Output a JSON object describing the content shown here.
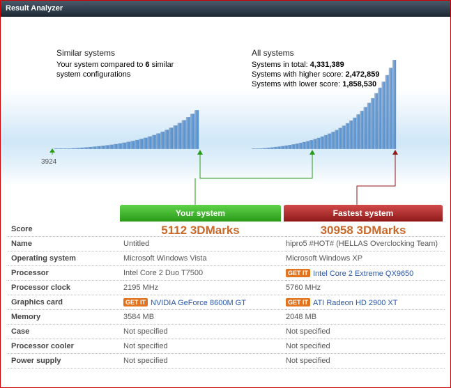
{
  "window": {
    "title": "Result Analyzer"
  },
  "similar": {
    "heading": "Similar systems",
    "line1_prefix": "Your system compared to ",
    "count": "6",
    "line1_suffix": " similar",
    "line2": "system configurations",
    "min_label": "3924"
  },
  "all": {
    "heading": "All systems",
    "total_label": "Systems in total: ",
    "total_value": "4,331,389",
    "higher_label": "Systems with higher score: ",
    "higher_value": "2,472,859",
    "lower_label": "Systems with lower score: ",
    "lower_value": "1,858,530"
  },
  "columns": {
    "yours": "Your system",
    "fastest": "Fastest system"
  },
  "scores": {
    "label": "Score",
    "yours": "5112 3DMarks",
    "fastest": "30958 3DMarks"
  },
  "rows": [
    {
      "label": "Name",
      "yours": "Untitled",
      "fastest": "hipro5 #HOT# (HELLAS Overclocking Team)"
    },
    {
      "label": "Operating system",
      "yours": "Microsoft Windows Vista",
      "fastest": "Microsoft Windows XP"
    },
    {
      "label": "Processor",
      "yours": "Intel Core 2 Duo T7500",
      "fastest": "Intel Core 2 Extreme QX9650"
    },
    {
      "label": "Processor clock",
      "yours": "2195 MHz",
      "fastest": "5760 MHz"
    },
    {
      "label": "Graphics card",
      "yours": "NVIDIA GeForce 8600M GT",
      "fastest": "ATI Radeon HD 2900 XT"
    },
    {
      "label": "Memory",
      "yours": "3584 MB",
      "fastest": "2048 MB"
    },
    {
      "label": "Case",
      "yours": "Not specified",
      "fastest": "Not specified"
    },
    {
      "label": "Processor cooler",
      "yours": "Not specified",
      "fastest": "Not specified"
    },
    {
      "label": "Power supply",
      "yours": "Not specified",
      "fastest": "Not specified"
    }
  ],
  "getit_label": "GET IT",
  "colors": {
    "green": "#2a9a18",
    "red": "#8e1a1a",
    "score": "#c8692a",
    "bars": "#2d6db5"
  }
}
